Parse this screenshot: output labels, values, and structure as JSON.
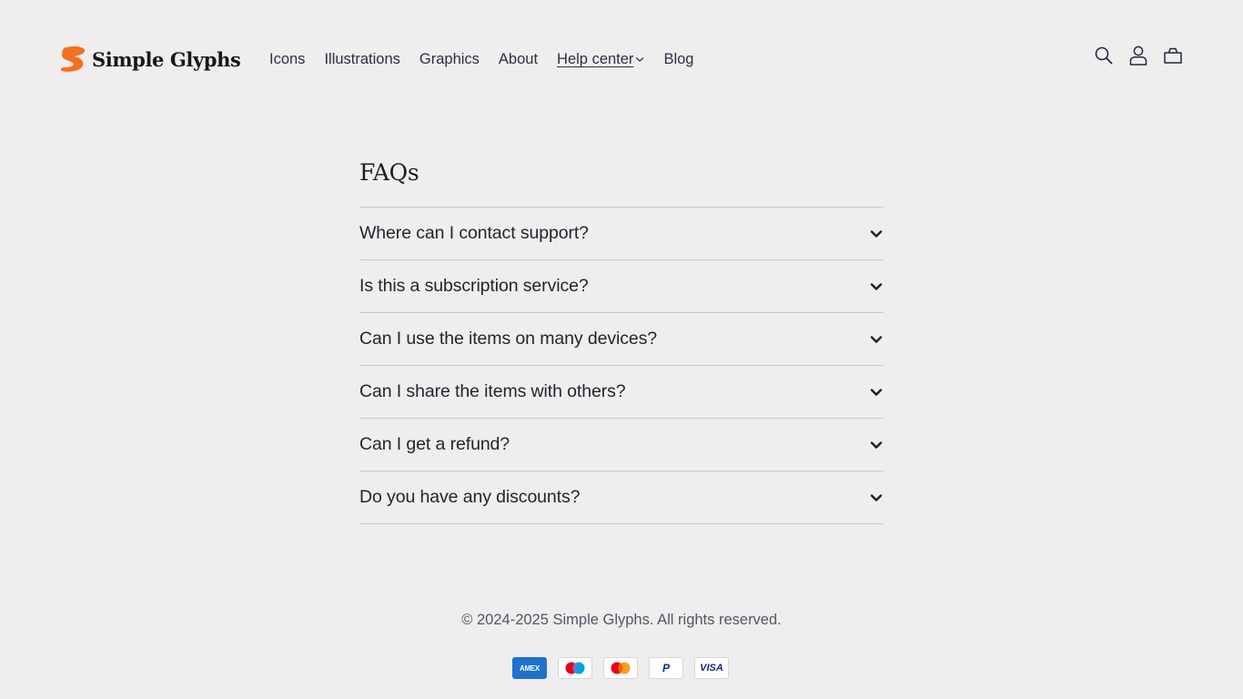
{
  "brand": {
    "name": "Simple Glyphs",
    "logo_icon": "brand-s-mark-icon",
    "accent_color": "#f37021"
  },
  "nav": {
    "items": [
      {
        "label": "Icons"
      },
      {
        "label": "Illustrations"
      },
      {
        "label": "Graphics"
      },
      {
        "label": "About"
      },
      {
        "label": "Help center",
        "active": true,
        "has_dropdown": true
      },
      {
        "label": "Blog"
      }
    ]
  },
  "header_icons": [
    "search-icon",
    "account-icon",
    "cart-icon"
  ],
  "faq": {
    "title": "FAQs",
    "items": [
      {
        "question": "Where can I contact support?"
      },
      {
        "question": "Is this a subscription service?"
      },
      {
        "question": "Can I use the items on many devices?"
      },
      {
        "question": "Can I share the items with others?"
      },
      {
        "question": "Can I get a refund?"
      },
      {
        "question": "Do you have any discounts?"
      }
    ]
  },
  "footer": {
    "copyright": "© 2024-2025 Simple Glyphs. All rights reserved.",
    "payment_methods": [
      {
        "name": "American Express",
        "mark": "AMEX"
      },
      {
        "name": "Maestro"
      },
      {
        "name": "Mastercard"
      },
      {
        "name": "PayPal",
        "mark": "P"
      },
      {
        "name": "Visa",
        "mark": "VISA"
      }
    ]
  }
}
